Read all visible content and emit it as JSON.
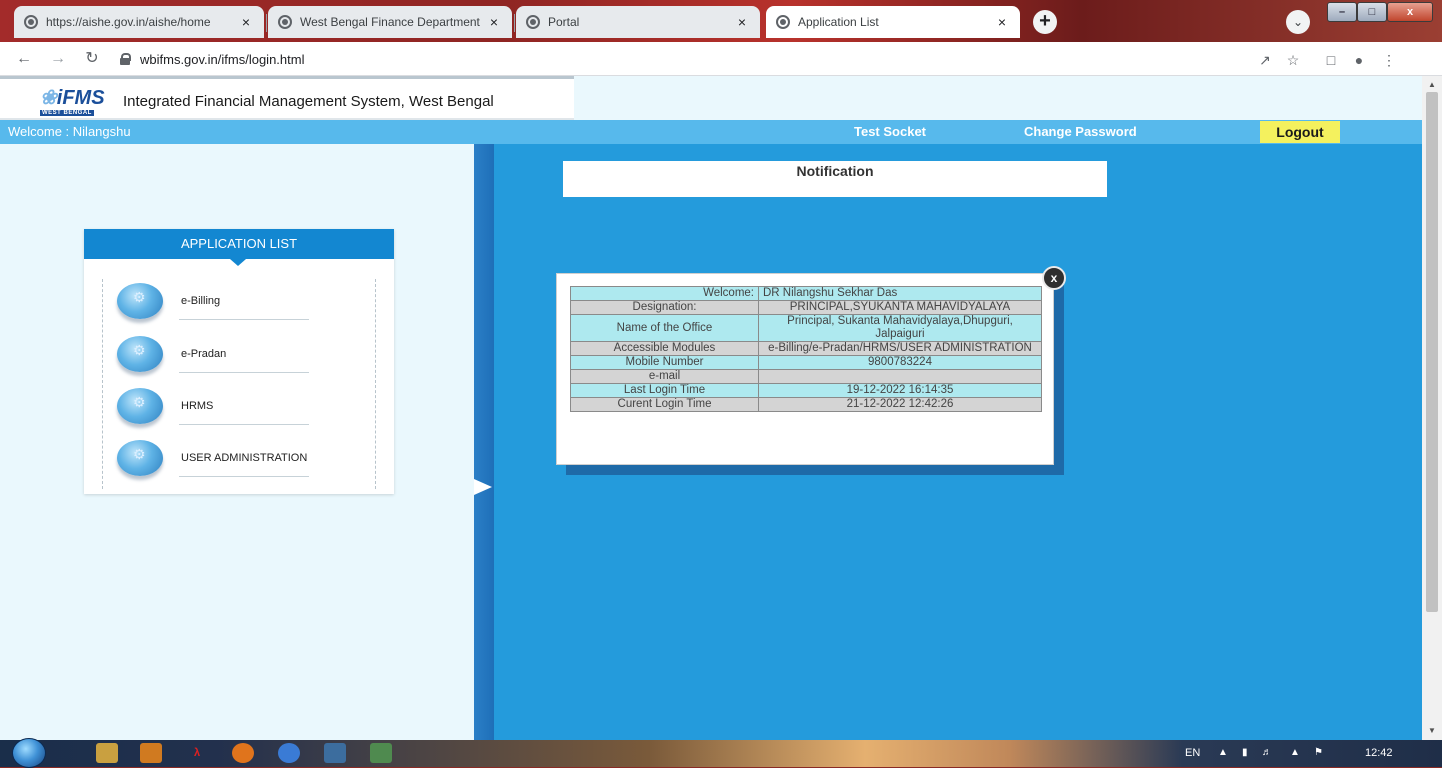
{
  "browser": {
    "tabs": [
      {
        "label": "https://aishe.gov.in/aishe/home",
        "active": false
      },
      {
        "label": "West Bengal Finance Department",
        "active": false
      },
      {
        "label": "Portal",
        "active": false
      },
      {
        "label": "Application List",
        "active": true
      }
    ],
    "tab_close_glyph": "×",
    "new_tab_glyph": "+",
    "url": "wbifms.gov.in/ifms/login.html",
    "window_buttons": {
      "minimize": "–",
      "maximize": "□",
      "close": "x"
    }
  },
  "site": {
    "logo": {
      "mark_leaf": "❀",
      "mark_text": "iFMS",
      "sub": "WEST BENGAL"
    },
    "title": "Integrated Financial Management System, West Bengal"
  },
  "menubar": {
    "welcome": "Welcome : Nilangshu",
    "test_socket": "Test Socket",
    "change_password": "Change Password",
    "logout": "Logout",
    "bar_color": "#57b9ec",
    "logout_color": "#f4f15e"
  },
  "app_list": {
    "heading": "APPLICATION LIST",
    "items": [
      {
        "label": "e-Billing",
        "icon": "gear-icon"
      },
      {
        "label": "e-Pradan",
        "icon": "gear-icon"
      },
      {
        "label": "HRMS",
        "icon": "gear-icon"
      },
      {
        "label": "USER ADMINISTRATION",
        "icon": "gear-icon"
      }
    ]
  },
  "notification": {
    "title": "Notification"
  },
  "popup": {
    "close_glyph": "x",
    "rows": [
      {
        "key": "Welcome:",
        "value": "DR Nilangshu Sekhar Das"
      },
      {
        "key": "Designation:",
        "value": "PRINCIPAL,SYUKANTA MAHAVIDYALAYA"
      },
      {
        "key": "Name of the Office",
        "value": "Principal, Sukanta Mahavidyalaya,Dhupguri, Jalpaiguri"
      },
      {
        "key": "Accessible Modules",
        "value": "e-Billing/e-Pradan/HRMS/USER ADMINISTRATION"
      },
      {
        "key": "Mobile Number",
        "value": "9800783224"
      },
      {
        "key": "e-mail",
        "value": ""
      },
      {
        "key": "Last Login Time",
        "value": "19-12-2022 16:14:35"
      },
      {
        "key": "Curent Login Time",
        "value": "21-12-2022 12:42:26"
      }
    ]
  },
  "colors": {
    "main_bg": "#249bdc",
    "left_bg": "#eaf8fd",
    "row_cyan": "#aee9ef",
    "row_gray": "#d4d4d4"
  },
  "taskbar": {
    "lang": "EN",
    "clock": "12:42"
  }
}
